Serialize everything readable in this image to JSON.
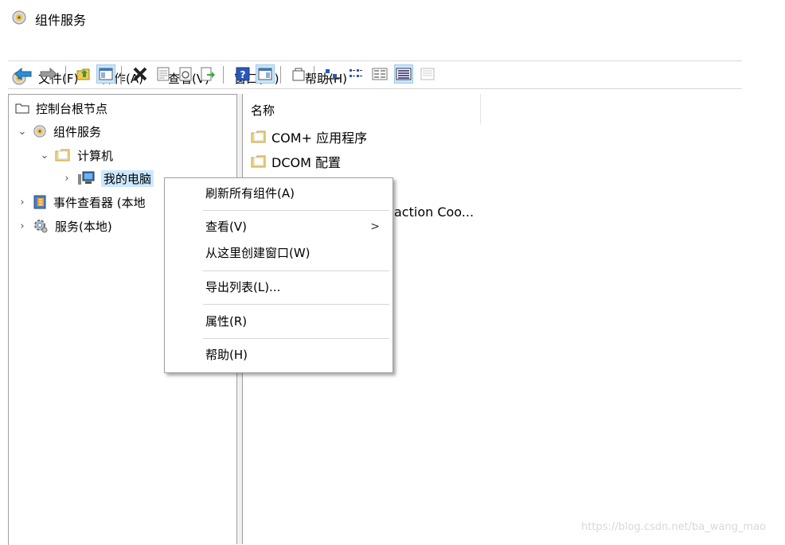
{
  "window": {
    "title": "组件服务"
  },
  "menubar": {
    "items": [
      {
        "label": "文件(F)"
      },
      {
        "label": "操作(A)"
      },
      {
        "label": "查看(V)"
      },
      {
        "label": "窗口(W)"
      },
      {
        "label": "帮助(H)"
      }
    ]
  },
  "toolbar": {
    "buttons": [
      {
        "icon": "back-arrow-icon"
      },
      {
        "icon": "forward-arrow-icon"
      },
      {
        "icon": "up-folder-icon"
      },
      {
        "icon": "show-hide-console-tree-icon"
      },
      {
        "icon": "delete-icon"
      },
      {
        "icon": "properties-icon"
      },
      {
        "icon": "refresh-icon"
      },
      {
        "icon": "export-list-icon"
      },
      {
        "icon": "help-icon"
      },
      {
        "icon": "show-hide-action-pane-icon"
      },
      {
        "icon": "new-window-icon"
      },
      {
        "icon": "large-icons-view-icon"
      },
      {
        "icon": "small-icons-view-icon"
      },
      {
        "icon": "list-view-icon"
      },
      {
        "icon": "detail-view-icon"
      },
      {
        "icon": "status-view-icon"
      }
    ]
  },
  "tree": {
    "root": "控制台根节点",
    "component_services": "组件服务",
    "computers": "计算机",
    "my_computer": "我的电脑",
    "event_viewer": "事件查看器 (本地",
    "services": "服务(本地)"
  },
  "list": {
    "column_name": "名称",
    "rows": [
      {
        "label": "COM+ 应用程序"
      },
      {
        "label": "DCOM 配置"
      },
      {
        "label": "action Coo..."
      }
    ]
  },
  "context_menu": {
    "items": [
      {
        "label": "刷新所有组件(A)"
      },
      {
        "label": "查看(V)",
        "has_submenu": true
      },
      {
        "label": "从这里创建窗口(W)"
      },
      {
        "label": "导出列表(L)..."
      },
      {
        "label": "属性(R)"
      },
      {
        "label": "帮助(H)"
      }
    ],
    "submenu_arrow": ">"
  },
  "watermark": "https://blog.csdn.net/ba_wang_mao",
  "colors": {
    "selection": "#cce8ff",
    "folder": "#f5d77a",
    "accent_blue": "#2a75c9"
  }
}
